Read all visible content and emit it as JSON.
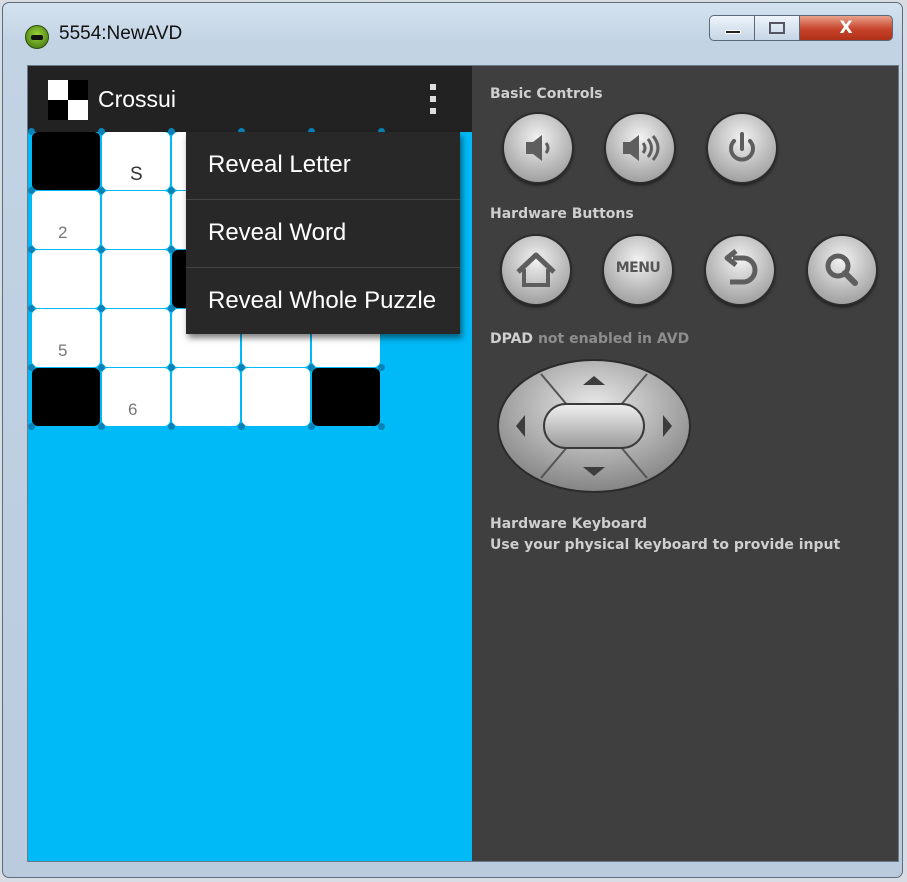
{
  "window": {
    "title": "5554:NewAVD",
    "close_glyph": "X",
    "icon": "android-emulator-icon"
  },
  "app": {
    "title": "Crossui",
    "icon": "crossword-app-icon",
    "overflow_icon": "overflow-menu-icon"
  },
  "overflow_menu": {
    "items": [
      {
        "label": "Reveal Letter"
      },
      {
        "label": "Reveal Word"
      },
      {
        "label": "Reveal Whole Puzzle"
      }
    ]
  },
  "crossword": {
    "rows": [
      [
        {
          "type": "black"
        },
        {
          "type": "white",
          "letter": "S"
        },
        {
          "type": "white"
        },
        {
          "type": "white"
        },
        {
          "type": "white"
        }
      ],
      [
        {
          "type": "white",
          "number": "2"
        },
        {
          "type": "white"
        },
        {
          "type": "white"
        },
        {
          "type": "white"
        },
        {
          "type": "white"
        }
      ],
      [
        {
          "type": "white"
        },
        {
          "type": "white"
        },
        {
          "type": "black"
        },
        {
          "type": "white"
        },
        {
          "type": "white"
        }
      ],
      [
        {
          "type": "white",
          "number": "5"
        },
        {
          "type": "white"
        },
        {
          "type": "white"
        },
        {
          "type": "white"
        },
        {
          "type": "white"
        }
      ],
      [
        {
          "type": "black"
        },
        {
          "type": "white",
          "number": "6"
        },
        {
          "type": "white"
        },
        {
          "type": "white"
        },
        {
          "type": "black"
        }
      ]
    ]
  },
  "controls_panel": {
    "basic_controls": {
      "heading": "Basic Controls",
      "buttons": [
        {
          "icon": "volume-down-icon"
        },
        {
          "icon": "volume-up-icon"
        },
        {
          "icon": "power-icon"
        }
      ]
    },
    "hardware_buttons": {
      "heading": "Hardware Buttons",
      "buttons": [
        {
          "icon": "home-icon"
        },
        {
          "icon": "menu-button",
          "label": "MENU"
        },
        {
          "icon": "back-icon"
        },
        {
          "icon": "search-icon"
        }
      ]
    },
    "dpad": {
      "heading_strong": "DPAD",
      "heading_dim": "not enabled in AVD"
    },
    "keyboard": {
      "heading": "Hardware Keyboard",
      "description": "Use your physical keyboard to provide input"
    }
  },
  "colors": {
    "screen_background": "#00baf7",
    "action_bar": "#222222",
    "panel_background": "#3f3f3f",
    "menu_background": "#282828"
  }
}
